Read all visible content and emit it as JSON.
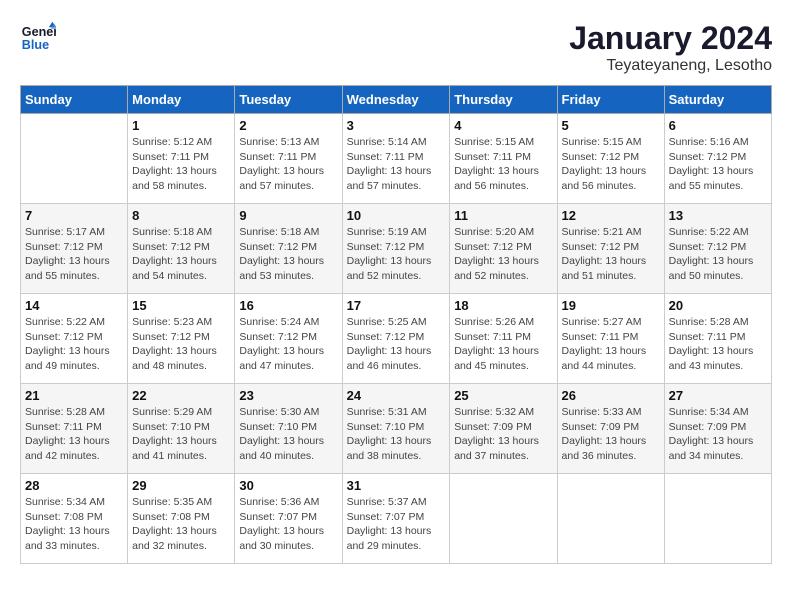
{
  "header": {
    "logo_line1": "General",
    "logo_line2": "Blue",
    "month": "January 2024",
    "location": "Teyateyaneng, Lesotho"
  },
  "columns": [
    "Sunday",
    "Monday",
    "Tuesday",
    "Wednesday",
    "Thursday",
    "Friday",
    "Saturday"
  ],
  "weeks": [
    [
      {
        "day": "",
        "sunrise": "",
        "sunset": "",
        "daylight": ""
      },
      {
        "day": "1",
        "sunrise": "5:12 AM",
        "sunset": "7:11 PM",
        "daylight": "13 hours and 58 minutes."
      },
      {
        "day": "2",
        "sunrise": "5:13 AM",
        "sunset": "7:11 PM",
        "daylight": "13 hours and 57 minutes."
      },
      {
        "day": "3",
        "sunrise": "5:14 AM",
        "sunset": "7:11 PM",
        "daylight": "13 hours and 57 minutes."
      },
      {
        "day": "4",
        "sunrise": "5:15 AM",
        "sunset": "7:11 PM",
        "daylight": "13 hours and 56 minutes."
      },
      {
        "day": "5",
        "sunrise": "5:15 AM",
        "sunset": "7:12 PM",
        "daylight": "13 hours and 56 minutes."
      },
      {
        "day": "6",
        "sunrise": "5:16 AM",
        "sunset": "7:12 PM",
        "daylight": "13 hours and 55 minutes."
      }
    ],
    [
      {
        "day": "7",
        "sunrise": "5:17 AM",
        "sunset": "7:12 PM",
        "daylight": "13 hours and 55 minutes."
      },
      {
        "day": "8",
        "sunrise": "5:18 AM",
        "sunset": "7:12 PM",
        "daylight": "13 hours and 54 minutes."
      },
      {
        "day": "9",
        "sunrise": "5:18 AM",
        "sunset": "7:12 PM",
        "daylight": "13 hours and 53 minutes."
      },
      {
        "day": "10",
        "sunrise": "5:19 AM",
        "sunset": "7:12 PM",
        "daylight": "13 hours and 52 minutes."
      },
      {
        "day": "11",
        "sunrise": "5:20 AM",
        "sunset": "7:12 PM",
        "daylight": "13 hours and 52 minutes."
      },
      {
        "day": "12",
        "sunrise": "5:21 AM",
        "sunset": "7:12 PM",
        "daylight": "13 hours and 51 minutes."
      },
      {
        "day": "13",
        "sunrise": "5:22 AM",
        "sunset": "7:12 PM",
        "daylight": "13 hours and 50 minutes."
      }
    ],
    [
      {
        "day": "14",
        "sunrise": "5:22 AM",
        "sunset": "7:12 PM",
        "daylight": "13 hours and 49 minutes."
      },
      {
        "day": "15",
        "sunrise": "5:23 AM",
        "sunset": "7:12 PM",
        "daylight": "13 hours and 48 minutes."
      },
      {
        "day": "16",
        "sunrise": "5:24 AM",
        "sunset": "7:12 PM",
        "daylight": "13 hours and 47 minutes."
      },
      {
        "day": "17",
        "sunrise": "5:25 AM",
        "sunset": "7:12 PM",
        "daylight": "13 hours and 46 minutes."
      },
      {
        "day": "18",
        "sunrise": "5:26 AM",
        "sunset": "7:11 PM",
        "daylight": "13 hours and 45 minutes."
      },
      {
        "day": "19",
        "sunrise": "5:27 AM",
        "sunset": "7:11 PM",
        "daylight": "13 hours and 44 minutes."
      },
      {
        "day": "20",
        "sunrise": "5:28 AM",
        "sunset": "7:11 PM",
        "daylight": "13 hours and 43 minutes."
      }
    ],
    [
      {
        "day": "21",
        "sunrise": "5:28 AM",
        "sunset": "7:11 PM",
        "daylight": "13 hours and 42 minutes."
      },
      {
        "day": "22",
        "sunrise": "5:29 AM",
        "sunset": "7:10 PM",
        "daylight": "13 hours and 41 minutes."
      },
      {
        "day": "23",
        "sunrise": "5:30 AM",
        "sunset": "7:10 PM",
        "daylight": "13 hours and 40 minutes."
      },
      {
        "day": "24",
        "sunrise": "5:31 AM",
        "sunset": "7:10 PM",
        "daylight": "13 hours and 38 minutes."
      },
      {
        "day": "25",
        "sunrise": "5:32 AM",
        "sunset": "7:09 PM",
        "daylight": "13 hours and 37 minutes."
      },
      {
        "day": "26",
        "sunrise": "5:33 AM",
        "sunset": "7:09 PM",
        "daylight": "13 hours and 36 minutes."
      },
      {
        "day": "27",
        "sunrise": "5:34 AM",
        "sunset": "7:09 PM",
        "daylight": "13 hours and 34 minutes."
      }
    ],
    [
      {
        "day": "28",
        "sunrise": "5:34 AM",
        "sunset": "7:08 PM",
        "daylight": "13 hours and 33 minutes."
      },
      {
        "day": "29",
        "sunrise": "5:35 AM",
        "sunset": "7:08 PM",
        "daylight": "13 hours and 32 minutes."
      },
      {
        "day": "30",
        "sunrise": "5:36 AM",
        "sunset": "7:07 PM",
        "daylight": "13 hours and 30 minutes."
      },
      {
        "day": "31",
        "sunrise": "5:37 AM",
        "sunset": "7:07 PM",
        "daylight": "13 hours and 29 minutes."
      },
      {
        "day": "",
        "sunrise": "",
        "sunset": "",
        "daylight": ""
      },
      {
        "day": "",
        "sunrise": "",
        "sunset": "",
        "daylight": ""
      },
      {
        "day": "",
        "sunrise": "",
        "sunset": "",
        "daylight": ""
      }
    ]
  ],
  "labels": {
    "sunrise_prefix": "Sunrise: ",
    "sunset_prefix": "Sunset: ",
    "daylight_prefix": "Daylight: "
  }
}
